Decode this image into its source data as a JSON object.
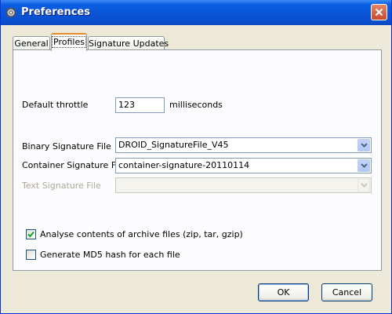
{
  "window": {
    "title": "Preferences",
    "close_tooltip": "",
    "colors": {
      "titlebar": "#0a53d6",
      "close": "#c64a2b",
      "face": "#ece9d8",
      "tab_highlight": "#e68b2c",
      "checkmark": "#21a121"
    }
  },
  "tabs": [
    {
      "label": "General",
      "active": false
    },
    {
      "label": "Profiles",
      "active": true
    },
    {
      "label": "Signature Updates",
      "active": false
    }
  ],
  "throttle": {
    "label": "Default throttle",
    "value": "123",
    "unit": "milliseconds"
  },
  "binary_signature": {
    "label": "Binary Signature File",
    "selected": "DROID_SignatureFile_V45"
  },
  "container_signature": {
    "label": "Container Signature File",
    "selected": "container-signature-20110114"
  },
  "text_signature": {
    "label": "Text Signature File",
    "selected": "",
    "enabled": false
  },
  "options": {
    "analyse_archives": {
      "label": "Analyse contents of archive files (zip, tar, gzip)",
      "checked": true
    },
    "generate_md5": {
      "label": "Generate MD5 hash for each file",
      "checked": false
    }
  },
  "buttons": {
    "ok": "OK",
    "cancel": "Cancel"
  }
}
